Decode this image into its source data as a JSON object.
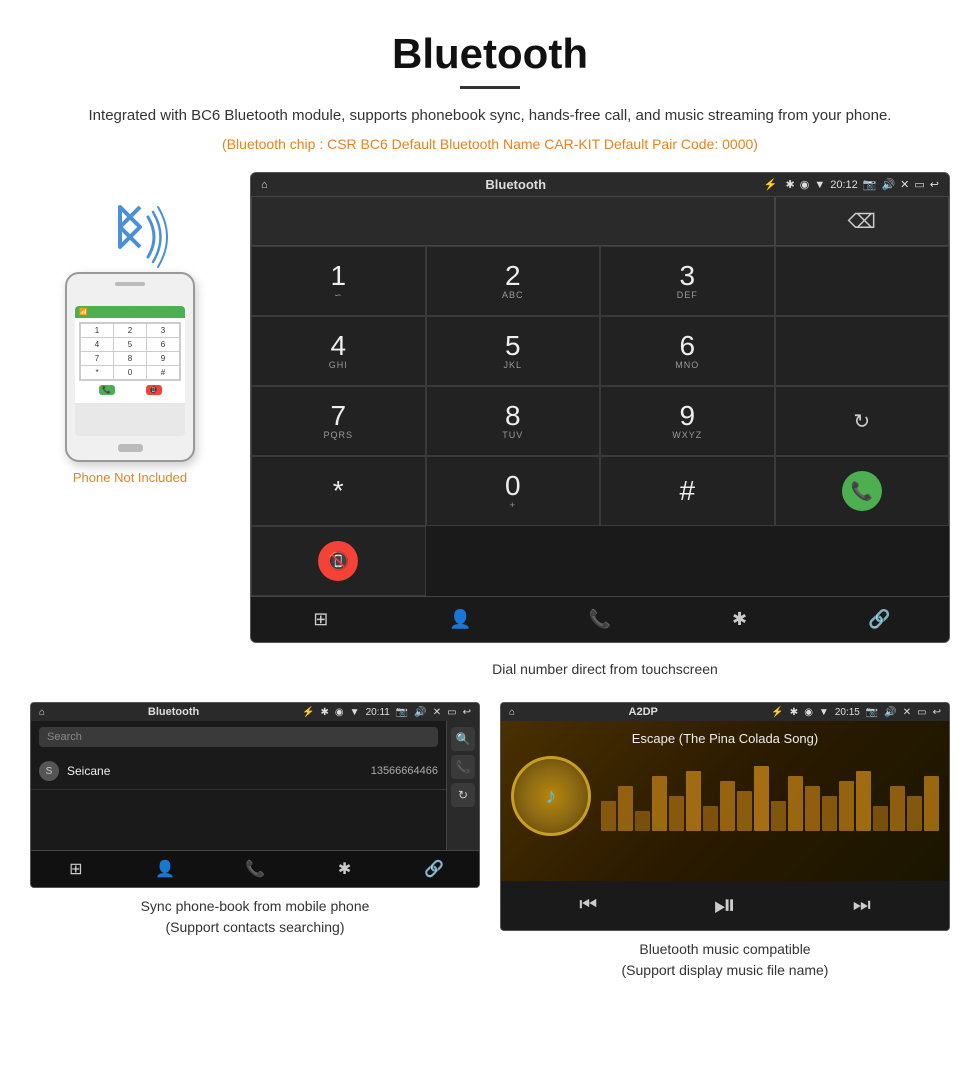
{
  "title": "Bluetooth",
  "subtitle": "Integrated with BC6 Bluetooth module, supports phonebook sync, hands-free call, and music streaming from your phone.",
  "spec_text": "(Bluetooth chip : CSR BC6    Default Bluetooth Name CAR-KIT    Default Pair Code: 0000)",
  "phone_label": "Phone Not Included",
  "dial_caption": "Dial number direct from touchscreen",
  "phonebook_caption_line1": "Sync phone-book from mobile phone",
  "phonebook_caption_line2": "(Support contacts searching)",
  "music_caption_line1": "Bluetooth music compatible",
  "music_caption_line2": "(Support display music file name)",
  "dialer": {
    "app_title": "Bluetooth",
    "time": "20:12",
    "keys": [
      {
        "num": "1",
        "sub": ""
      },
      {
        "num": "2",
        "sub": "ABC"
      },
      {
        "num": "3",
        "sub": "DEF"
      },
      {
        "num": "4",
        "sub": "GHI"
      },
      {
        "num": "5",
        "sub": "JKL"
      },
      {
        "num": "6",
        "sub": "MNO"
      },
      {
        "num": "7",
        "sub": "PQRS"
      },
      {
        "num": "8",
        "sub": "TUV"
      },
      {
        "num": "9",
        "sub": "WXYZ"
      },
      {
        "num": "*",
        "sub": ""
      },
      {
        "num": "0",
        "sub": "+"
      },
      {
        "num": "#",
        "sub": ""
      }
    ]
  },
  "phonebook": {
    "app_title": "Bluetooth",
    "time": "20:11",
    "search_placeholder": "Search",
    "contact_name": "Seicane",
    "contact_number": "13566664466"
  },
  "music": {
    "app_title": "A2DP",
    "time": "20:15",
    "song_title": "Escape (The Pina Colada Song)",
    "viz_heights": [
      30,
      45,
      20,
      55,
      35,
      60,
      25,
      50,
      40,
      65,
      30,
      55,
      45,
      35,
      50,
      60,
      25,
      45,
      35,
      55
    ]
  }
}
